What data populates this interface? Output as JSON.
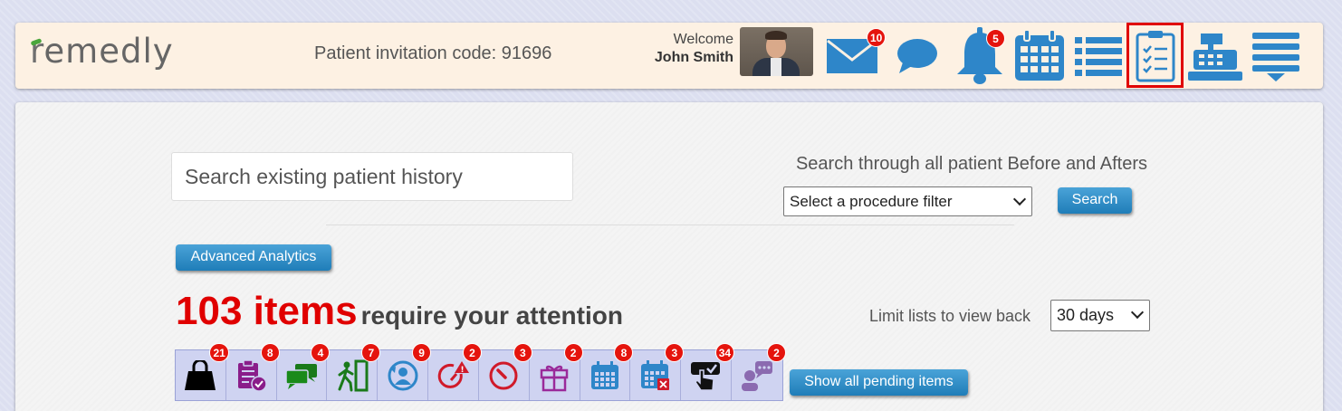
{
  "header": {
    "logo": "remedly",
    "invitation_code": "Patient invitation code: 91696",
    "welcome": "Welcome",
    "user_name": "John Smith",
    "mail_badge": "10",
    "notifications_badge": "5",
    "icons": [
      "mail-icon",
      "chat-icon",
      "bell-icon",
      "calendar-icon",
      "list-icon",
      "checklist-icon",
      "cash-register-icon",
      "menu-icon"
    ],
    "accent_color": "#2e86c9"
  },
  "search": {
    "placeholder": "Search existing patient history",
    "before_after_label": "Search through all patient Before and Afters",
    "procedure_filter": "Select a procedure filter",
    "search_button": "Search"
  },
  "analytics_button": "Advanced Analytics",
  "attention": {
    "count": "103 items",
    "text": "require your attention"
  },
  "limit": {
    "label": "Limit lists to view back",
    "value": "30 days"
  },
  "pending": {
    "items": [
      {
        "icon": "shopping-bag-icon",
        "badge": "21"
      },
      {
        "icon": "clipboard-check-icon",
        "badge": "8"
      },
      {
        "icon": "messages-icon",
        "badge": "4"
      },
      {
        "icon": "exit-icon",
        "badge": "7"
      },
      {
        "icon": "user-refresh-icon",
        "badge": "9"
      },
      {
        "icon": "gauge-alert-icon",
        "badge": "2"
      },
      {
        "icon": "gauge-icon",
        "badge": "3"
      },
      {
        "icon": "gift-icon",
        "badge": "2"
      },
      {
        "icon": "calendar-grid-icon",
        "badge": "8"
      },
      {
        "icon": "calendar-cancel-icon",
        "badge": "3"
      },
      {
        "icon": "tap-check-icon",
        "badge": "34"
      },
      {
        "icon": "user-chat-icon",
        "badge": "2"
      }
    ],
    "show_all_button": "Show all pending items"
  }
}
